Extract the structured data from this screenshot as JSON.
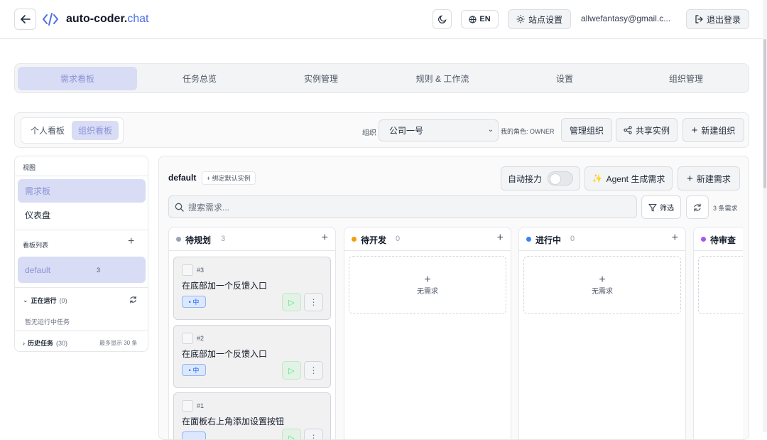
{
  "header": {
    "brand_main": "auto-coder.",
    "brand_accent": "chat",
    "lang": "EN",
    "site_settings": "站点设置",
    "email": "allwefantasy@gmail.c...",
    "logout": "退出登录"
  },
  "nav": {
    "tabs": [
      {
        "label": "需求看板",
        "active": true
      },
      {
        "label": "任务总览"
      },
      {
        "label": "实例管理"
      },
      {
        "label": "规则 & 工作流"
      },
      {
        "label": "设置"
      },
      {
        "label": "组织管理"
      }
    ]
  },
  "board_bar": {
    "personal": "个人看板",
    "org": "组织看板",
    "org_label": "组织",
    "org_value": "公司一号",
    "role": "我的角色: OWNER",
    "manage": "管理组织",
    "share": "共享实例",
    "create": "新建组织"
  },
  "sidebar": {
    "view_heading": "视图",
    "views": [
      "需求板",
      "仪表盘"
    ],
    "list_heading": "看板列表",
    "boards": [
      {
        "name": "default",
        "count": "3"
      }
    ],
    "running_label": "正在运行",
    "running_count": "(0)",
    "running_empty": "暂无运行中任务",
    "history_label": "历史任务",
    "history_count": "(30)",
    "history_note": "最多显示 30 条"
  },
  "main": {
    "board_name": "default",
    "bind_default": "+ 绑定默认实例",
    "auto_relay": "自动接力",
    "agent_generate": "Agent 生成需求",
    "new_requirement": "新建需求",
    "search_placeholder": "搜索需求...",
    "filter": "筛选",
    "total": "3 条需求"
  },
  "columns": [
    {
      "title": "待规划",
      "count": "3",
      "color": "#9ca3af"
    },
    {
      "title": "待开发",
      "count": "0",
      "color": "#f59e0b",
      "empty": "无需求"
    },
    {
      "title": "进行中",
      "count": "0",
      "color": "#3b82f6",
      "empty": "无需求"
    },
    {
      "title": "待审查",
      "color": "#a855f7"
    }
  ],
  "cards": [
    {
      "id": "#3",
      "title": "在底部加一个反馈入口",
      "priority": "• 中"
    },
    {
      "id": "#2",
      "title": "在底部加一个反馈入口",
      "priority": "• 中"
    },
    {
      "id": "#1",
      "title": "在面板右上角添加设置按钮"
    }
  ]
}
